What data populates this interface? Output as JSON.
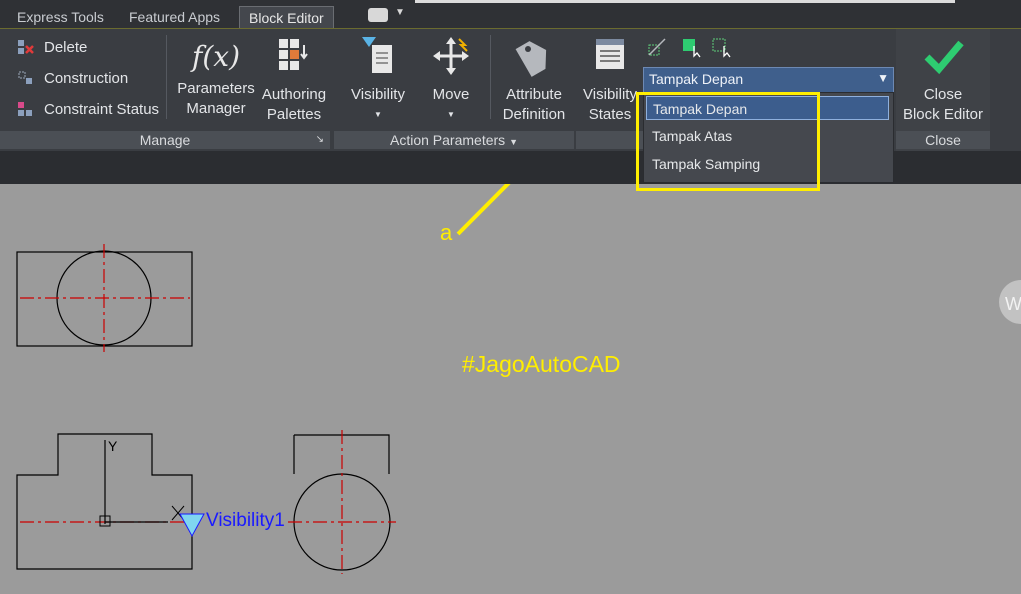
{
  "tabs": [
    {
      "label": "Express Tools"
    },
    {
      "label": "Featured Apps"
    },
    {
      "label": "Block Editor"
    }
  ],
  "manage": {
    "delete": "Delete",
    "construction": "Construction",
    "constraint_status": "Constraint Status",
    "parameters_manager": [
      "Parameters",
      "Manager"
    ],
    "authoring_palettes": [
      "Authoring",
      "Palettes"
    ],
    "panel_label": "Manage"
  },
  "action": {
    "visibility": "Visibility",
    "move": "Move",
    "attribute_definition": [
      "Attribute",
      "Definition"
    ],
    "visibility_states": [
      "Visibility",
      "States"
    ],
    "panel_label": "Action Parameters"
  },
  "visibility_dropdown": {
    "current": "Tampak Depan",
    "options": [
      "Tampak Depan",
      "Tampak Atas",
      "Tampak Samping"
    ]
  },
  "close": {
    "button": [
      "Close",
      "Block Editor"
    ],
    "panel_label": "Close"
  },
  "canvas": {
    "watermark": "#JagoAutoCAD",
    "annotation_letter": "a",
    "param_label": "Visibility1",
    "ucs_y": "Y",
    "edge_glyph": "W"
  },
  "colors": {
    "ribbon": "#3a3d42",
    "canvas": "#9b9b9b",
    "highlight": "#ffee00",
    "selected": "#3c5d8d",
    "check": "#2ecc71",
    "centerline": "#cc0000",
    "param": "#1a1aff"
  }
}
